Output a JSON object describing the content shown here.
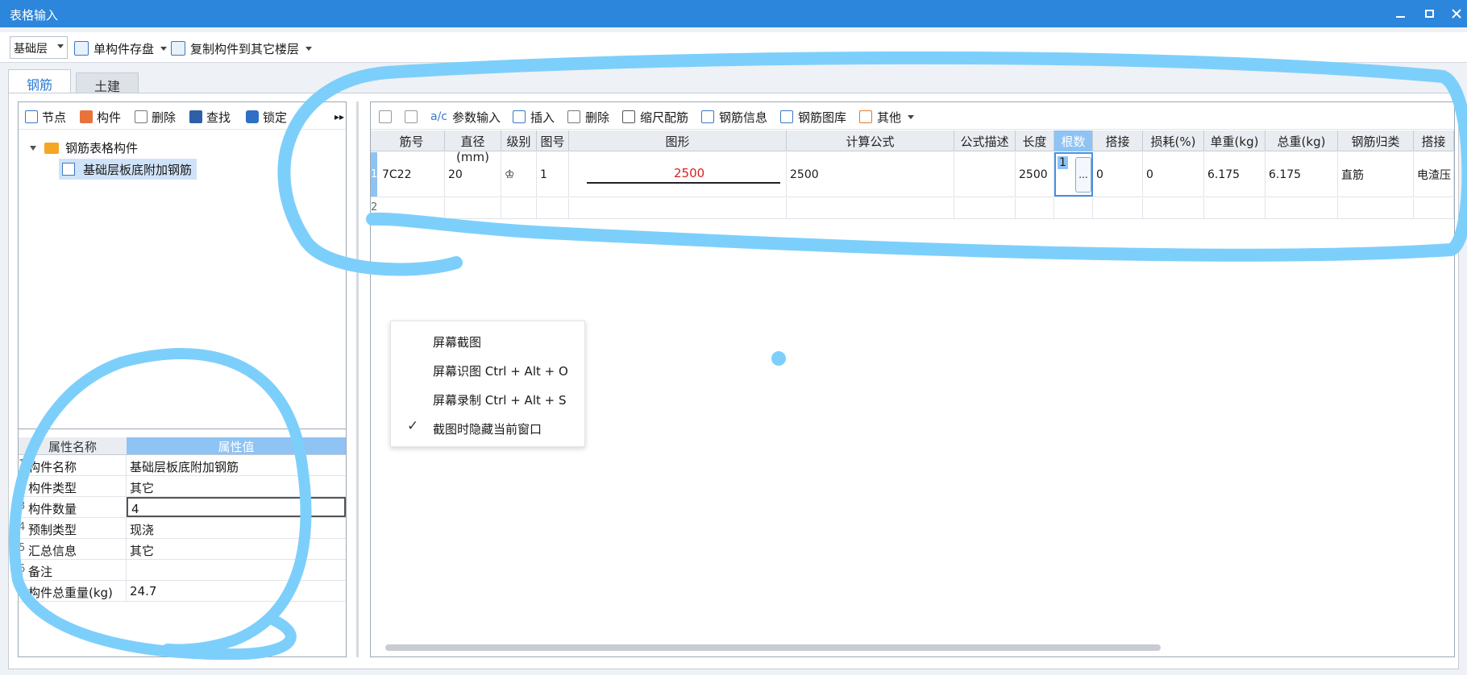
{
  "window": {
    "title": "表格输入",
    "minimize_icon": "minimize-icon",
    "maximize_icon": "maximize-icon",
    "close_icon": "close-icon"
  },
  "toolbar": {
    "floor_value": "基础层",
    "save_component": "单构件存盘",
    "copy_to_floor": "复制构件到其它楼层"
  },
  "tabs": [
    {
      "label": "钢筋",
      "active": true
    },
    {
      "label": "土建",
      "active": false
    }
  ],
  "left_toolbar": {
    "node": "节点",
    "component": "构件",
    "delete": "删除",
    "find": "查找",
    "lock": "锁定"
  },
  "tree": {
    "root": "钢筋表格构件",
    "child": "基础层板底附加钢筋"
  },
  "properties": {
    "header_name": "属性名称",
    "header_value": "属性值",
    "rows": [
      {
        "num": "1",
        "name": "构件名称",
        "value": "基础层板底附加钢筋"
      },
      {
        "num": "2",
        "name": "构件类型",
        "value": "其它"
      },
      {
        "num": "3",
        "name": "构件数量",
        "value": "4"
      },
      {
        "num": "4",
        "name": "预制类型",
        "value": "现浇"
      },
      {
        "num": "5",
        "name": "汇总信息",
        "value": "其它"
      },
      {
        "num": "6",
        "name": "备注",
        "value": ""
      },
      {
        "num": "7",
        "name": "构件总重量(kg)",
        "value": "24.7"
      }
    ]
  },
  "right_toolbar": {
    "param_input": "参数输入",
    "insert": "插入",
    "delete": "删除",
    "scale_rebar": "缩尺配筋",
    "rebar_info": "钢筋信息",
    "rebar_library": "钢筋图库",
    "other": "其他"
  },
  "grid": {
    "headers": [
      "筋号",
      "直径(mm)",
      "级别",
      "图号",
      "图形",
      "计算公式",
      "公式描述",
      "长度",
      "根数",
      "搭接",
      "损耗(%)",
      "单重(kg)",
      "总重(kg)",
      "钢筋归类",
      "搭接"
    ],
    "rows": [
      {
        "num": "1",
        "bar_no": "7C22",
        "diameter": "20",
        "grade": "♔",
        "shape_no": "1",
        "shape_value": "2500",
        "formula": "2500",
        "formula_desc": "",
        "length": "2500",
        "count": "1",
        "count_button": "...",
        "lap": "0",
        "loss": "0",
        "unit_weight": "6.175",
        "total_weight": "6.175",
        "category": "直筋",
        "lap_type": "电渣压"
      },
      {
        "num": "2"
      }
    ]
  },
  "context_menu": {
    "items": [
      {
        "label": "屏幕截图",
        "checked": false
      },
      {
        "label": "屏幕识图 Ctrl + Alt + O",
        "checked": false
      },
      {
        "label": "屏幕录制 Ctrl + Alt + S",
        "checked": false
      },
      {
        "label": "截图时隐藏当前窗口",
        "checked": true
      }
    ],
    "check_mark": "✓"
  },
  "colors": {
    "titlebar": "#2b86dc",
    "accent": "#2b7bd3",
    "selected_header": "#8ec3f3",
    "annotation": "#7dcffb",
    "shape_value": "#d62020"
  }
}
